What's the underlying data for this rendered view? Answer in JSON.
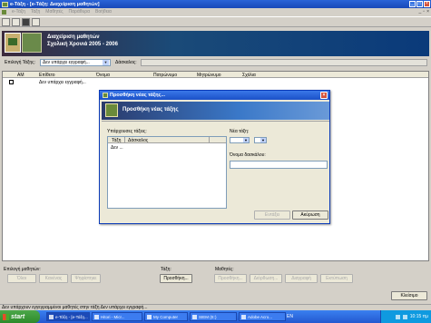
{
  "window": {
    "title": "e-Τάξη - [e-Τάξη: Διαχείριση μαθητών]"
  },
  "menu": [
    "e-Τάξη",
    "Τάξη",
    "Μαθητές",
    "Παράθυρα",
    "Βοήθεια"
  ],
  "banner": {
    "line1": "Διαχείριση μαθητών",
    "line2": "Σχολική Χρονιά 2005 - 2006"
  },
  "filter": {
    "class_label": "Επιλογή Τάξης:",
    "class_value": "Δεν υπάρχει εγγραφή...",
    "teacher_label": "Δάσκαλος:"
  },
  "grid": {
    "columns": [
      "ΑΜ",
      "Επίθετο",
      "Όνομα",
      "Πατρώνυμο",
      "Μητρώνυμο",
      "Σχόλια"
    ],
    "row": {
      "surname": "Δεν υπάρχει εγγραφή..."
    }
  },
  "bottom": {
    "select_students_label": "Επιλογή μαθητών:",
    "select_buttons": [
      "Όλοι",
      "Κανένας",
      "Ψηφίστηκε"
    ],
    "class_label": "Τάξη:",
    "add_button": "Προσθήκη...",
    "students_label": "Μαθητές:",
    "student_buttons": [
      "Προσθήκη...",
      "Διόρθωση...",
      "Διαγραφή",
      "Εκτύπωση"
    ],
    "close_button": "Κλείσιμο"
  },
  "status": "Δεν υπάρχουν εγγεγραμμένοι μαθητές στην τάξη Δεν υπάρχει εγγραφή...",
  "taskbar": {
    "start": "start",
    "tasks": [
      "e-Τάξη - [e-Τάξη...",
      "Hitori - Micr...",
      "My Computer",
      "SIEM (E:)",
      "Adobe Acro..."
    ],
    "language": "EN",
    "clock": "10:15 πμ"
  },
  "dialog": {
    "title": "Προσθήκη νέας τάξης...",
    "banner": "Προσθήκη νέας τάξης",
    "existing_label": "Υπάρχουσες τάξεις:",
    "list_columns": [
      "Τάξη",
      "Δάσκαλος"
    ],
    "list_row": "Δεν ...",
    "new_class_label": "Νέα τάξη:",
    "teacher_name_label": "Όνομα δασκάλου:",
    "ok_button": "Εντάξει",
    "cancel_button": "Ακύρωση"
  }
}
